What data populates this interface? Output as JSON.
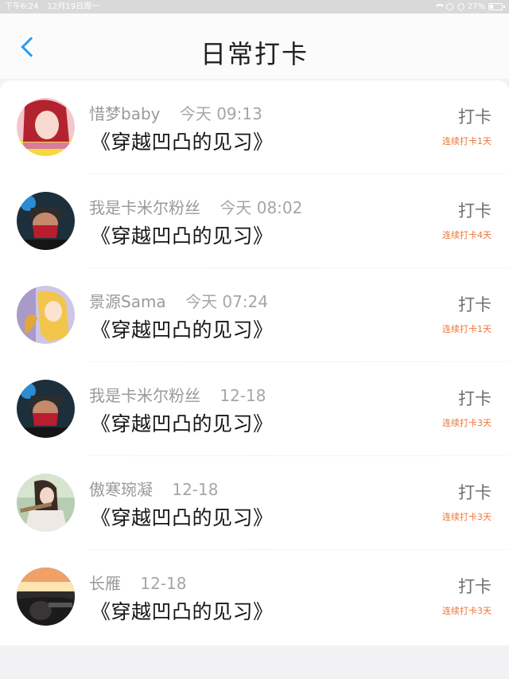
{
  "status_bar": {
    "time": "下午6:24",
    "date": "12月19日周一",
    "battery": "27%",
    "battery_level": 0.27,
    "icons": [
      "wifi-icon",
      "alarm-icon",
      "rotation-lock-icon",
      "battery-icon"
    ]
  },
  "nav": {
    "back_icon": "chevron-left-icon",
    "title": "日常打卡",
    "accent_color": "#2c9cf0"
  },
  "colors": {
    "streak": "#e9753a",
    "title_text": "#151515",
    "meta_text": "#9a9a9a"
  },
  "entries": [
    {
      "user": "惜梦baby",
      "time": "今天 09:13",
      "book": "《穿越凹凸的见习》",
      "checkin": "打卡",
      "streak": "连续打卡1天",
      "avatar": "avatar-girl-red"
    },
    {
      "user": "我是卡米尔粉丝",
      "time": "今天 08:02",
      "book": "《穿越凹凸的见习》",
      "checkin": "打卡",
      "streak": "连续打卡4天",
      "avatar": "avatar-masked-boy"
    },
    {
      "user": "景源Sama",
      "time": "今天 07:24",
      "book": "《穿越凹凸的见习》",
      "checkin": "打卡",
      "streak": "连续打卡1天",
      "avatar": "avatar-anime-blonde"
    },
    {
      "user": "我是卡米尔粉丝",
      "time": "12-18",
      "book": "《穿越凹凸的见习》",
      "checkin": "打卡",
      "streak": "连续打卡3天",
      "avatar": "avatar-masked-boy"
    },
    {
      "user": "傲寒琬凝",
      "time": "12-18",
      "book": "《穿越凹凸的见习》",
      "checkin": "打卡",
      "streak": "连续打卡3天",
      "avatar": "avatar-girl-photo"
    },
    {
      "user": "长雁",
      "time": "12-18",
      "book": "《穿越凹凸的见习》",
      "checkin": "打卡",
      "streak": "连续打卡3天",
      "avatar": "avatar-car-sunset"
    }
  ]
}
